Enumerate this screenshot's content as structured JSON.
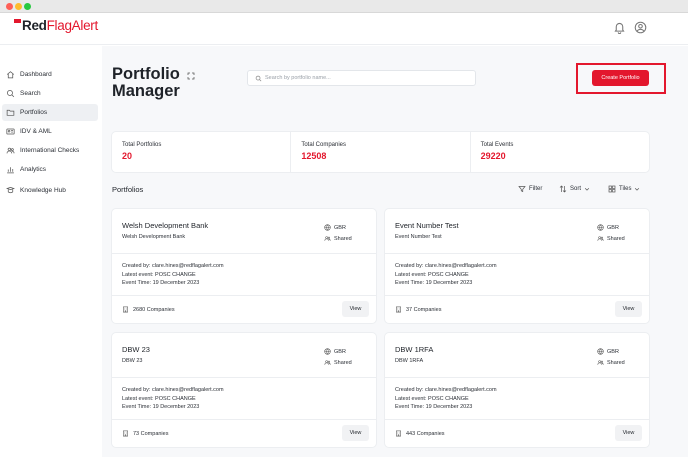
{
  "brand": {
    "logo_main": "Red",
    "logo_accent": "FlagAlert",
    "accent_color": "#e3172d"
  },
  "header": {
    "icons": [
      "bell-icon",
      "user-profile-icon"
    ]
  },
  "sidebar": {
    "items": [
      {
        "label": "Dashboard",
        "icon": "home-icon"
      },
      {
        "label": "Search",
        "icon": "search-icon"
      },
      {
        "label": "Portfolios",
        "icon": "folder-icon",
        "active": true
      },
      {
        "label": "IDV & AML",
        "icon": "id-card-icon"
      },
      {
        "label": "International Checks",
        "icon": "users-icon"
      },
      {
        "label": "Analytics",
        "icon": "chart-icon"
      },
      {
        "label": "Knowledge Hub",
        "icon": "book-icon"
      }
    ]
  },
  "main": {
    "title": "Portfolio Manager",
    "search_placeholder": "Search by portfolio name...",
    "create_button": "Create Portfolio",
    "stats": [
      {
        "label": "Total Portfolios",
        "value": "20"
      },
      {
        "label": "Total Companies",
        "value": "12508"
      },
      {
        "label": "Total Events",
        "value": "29220"
      }
    ],
    "section_title": "Portfolios",
    "toolbar": {
      "filter": "Filter",
      "sort": "Sort",
      "view": "Tiles"
    },
    "cards": [
      {
        "name": "Welsh Development Bank",
        "subtitle": "Welsh Development Bank",
        "country": "GBR",
        "sharing": "Shared",
        "created_by": "Created by: clare.hines@redflagalert.com",
        "latest_event": "Latest event: POSC CHANGE",
        "event_time": "Event Time: 19 December 2023",
        "companies": "2680 Companies",
        "view": "View"
      },
      {
        "name": "Event Number Test",
        "subtitle": "Event Number Test",
        "country": "GBR",
        "sharing": "Shared",
        "created_by": "Created by: clare.hines@redflagalert.com",
        "latest_event": "Latest event: POSC CHANGE",
        "event_time": "Event Time: 19 December 2023",
        "companies": "37 Companies",
        "view": "View"
      },
      {
        "name": "DBW 23",
        "subtitle": "DBW 23",
        "country": "GBR",
        "sharing": "Shared",
        "created_by": "Created by: clare.hines@redflagalert.com",
        "latest_event": "Latest event: POSC CHANGE",
        "event_time": "Event Time: 19 December 2023",
        "companies": "73 Companies",
        "view": "View"
      },
      {
        "name": "DBW 1RFA",
        "subtitle": "DBW 1RFA",
        "country": "GBR",
        "sharing": "Shared",
        "created_by": "Created by: clare.hines@redflagalert.com",
        "latest_event": "Latest event: POSC CHANGE",
        "event_time": "Event Time: 19 December 2023",
        "companies": "443 Companies",
        "view": "View"
      }
    ]
  }
}
